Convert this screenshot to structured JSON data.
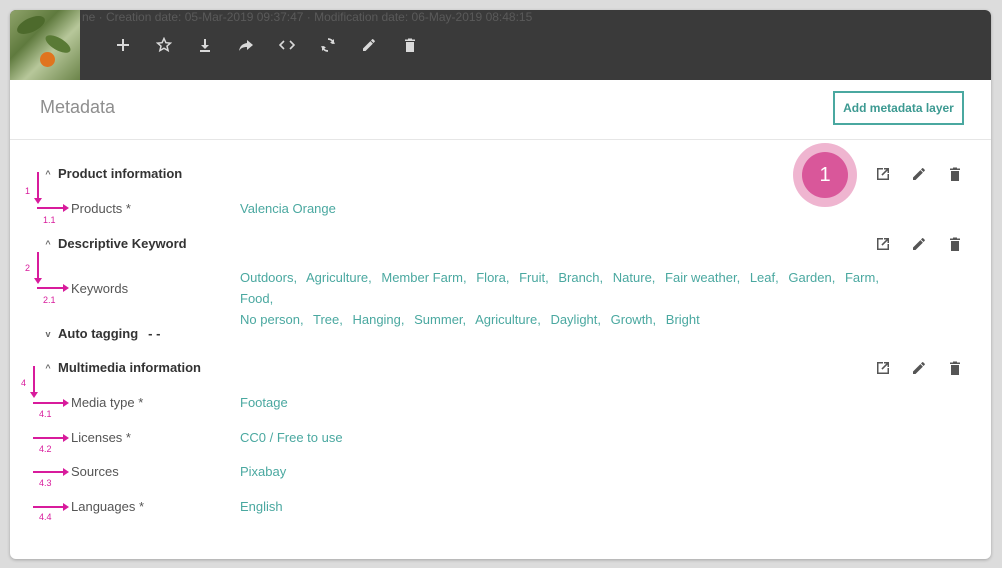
{
  "topbar": {
    "background_text": "ne · Creation date: 05-Mar-2019 09:37:47 · Modification date: 06-May-2019 08:48:15",
    "toolbar": [
      {
        "name": "add-icon",
        "glyph": "+"
      },
      {
        "name": "star-icon",
        "glyph": "☆"
      },
      {
        "name": "download-icon",
        "glyph": "⤓"
      },
      {
        "name": "share-icon",
        "glyph": "➦"
      },
      {
        "name": "code-icon",
        "glyph": "<>"
      },
      {
        "name": "sync-icon",
        "glyph": "⟳"
      },
      {
        "name": "edit-icon",
        "glyph": "✎"
      },
      {
        "name": "delete-icon",
        "glyph": "🗑"
      }
    ]
  },
  "header": {
    "title": "Metadata",
    "add_button": "Add metadata layer"
  },
  "sections": {
    "product": {
      "title": "Product information",
      "products_label": "Products *",
      "products_value": "Valencia Orange"
    },
    "keyword": {
      "title": "Descriptive Keyword",
      "keywords_label": "Keywords",
      "keywords": [
        "Outdoors,",
        "Agriculture,",
        "Member Farm,",
        "Flora,",
        "Fruit,",
        "Branch,",
        "Nature,",
        "Fair weather,",
        "Leaf,",
        "Garden,",
        "Farm,",
        "Food,",
        "No person,",
        "Tree,",
        "Hanging,",
        "Summer,",
        "Agriculture,",
        "Daylight,",
        "Growth,",
        "Bright"
      ]
    },
    "autotagging": {
      "title": "Auto tagging",
      "value": "- -"
    },
    "multimedia": {
      "title": "Multimedia information",
      "media_type_label": "Media type *",
      "media_type_value": "Footage",
      "licenses_label": "Licenses *",
      "licenses_value": "CC0 / Free to use",
      "sources_label": "Sources",
      "sources_value": "Pixabay",
      "languages_label": "Languages *",
      "languages_value": "English"
    }
  },
  "annotations": {
    "n1": "1",
    "n1_1": "1.1",
    "n2": "2",
    "n2_1": "2.1",
    "n4": "4",
    "n4_1": "4.1",
    "n4_2": "4.2",
    "n4_3": "4.3",
    "n4_4": "4.4",
    "badge": "1"
  },
  "colors": {
    "accent": "#4aa8a0",
    "annotation": "#d81b9c",
    "badge": "#d9579a",
    "topbar": "#3a3a3a"
  }
}
